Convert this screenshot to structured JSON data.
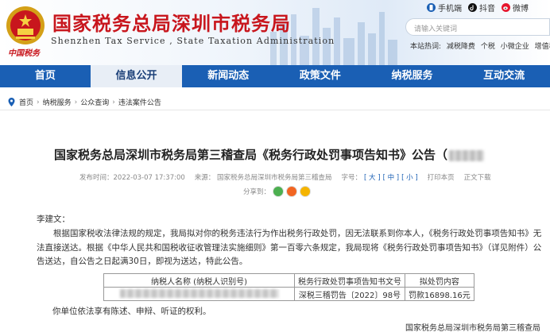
{
  "header": {
    "title": "国家税务总局深圳市税务局",
    "subtitle": "Shenzhen Tax Service , State Taxation Administration",
    "china_tax_text": "中国税务",
    "top_links": [
      {
        "icon": "mobile-icon",
        "label": "手机端"
      },
      {
        "icon": "douyin-icon",
        "label": "抖音"
      },
      {
        "icon": "weibo-icon",
        "label": "微博"
      }
    ],
    "search_placeholder": "请输入关键词",
    "hot_words_label": "本站热词:",
    "hot_words": [
      "减税降费",
      "个税",
      "小微企业",
      "增值税"
    ]
  },
  "nav": {
    "items": [
      {
        "label": "首页",
        "active": false
      },
      {
        "label": "信息公开",
        "active": true
      },
      {
        "label": "新闻动态",
        "active": false
      },
      {
        "label": "政策文件",
        "active": false
      },
      {
        "label": "纳税服务",
        "active": false
      },
      {
        "label": "互动交流",
        "active": false
      }
    ]
  },
  "breadcrumb": [
    "首页",
    "纳税服务",
    "公众查询",
    "违法案件公告"
  ],
  "article": {
    "title": "国家税务总局深圳市税务局第三稽查局《税务行政处罚事项告知书》公告（",
    "meta": {
      "publish_time": "发布时间：2022-03-07 17:37:00",
      "source": "来源：  国家税务总局深圳市税务局第三稽查局",
      "font_size_label": "字号：",
      "font_large": "[ 大 ]",
      "font_medium": "[ 中 ]",
      "font_small": "[ 小 ]",
      "print": "打印本页",
      "download": "正文下载"
    },
    "share_label": "分享到：",
    "salutation": "李建文：",
    "paragraph": "根据国家税收法律法规的规定，我局拟对你的税务违法行为作出税务行政处罚，因无法联系到你本人，《税务行政处罚事项告知书》无法直接送达。根据《中华人民共和国税收征收管理法实施细则》第一百零六条规定，我局现将《税务行政处罚事项告知书》（详见附件）公告送达，自公告之日起满30日，即视为送达，特此公告。",
    "table": {
      "headers": [
        "纳税人名称 (纳税人识别号)",
        "税务行政处罚事项告知书文号",
        "拟处罚内容"
      ],
      "row": [
        "",
        "深税三稽罚告〔2022〕98号",
        "罚款16898.16元"
      ]
    },
    "rights": "你单位依法享有陈述、申辩、听证的权利。",
    "signature": "国家税务总局深圳市税务局第三稽查局"
  },
  "colors": {
    "brand_red": "#c8161d",
    "nav_blue": "#1a5fb4"
  }
}
